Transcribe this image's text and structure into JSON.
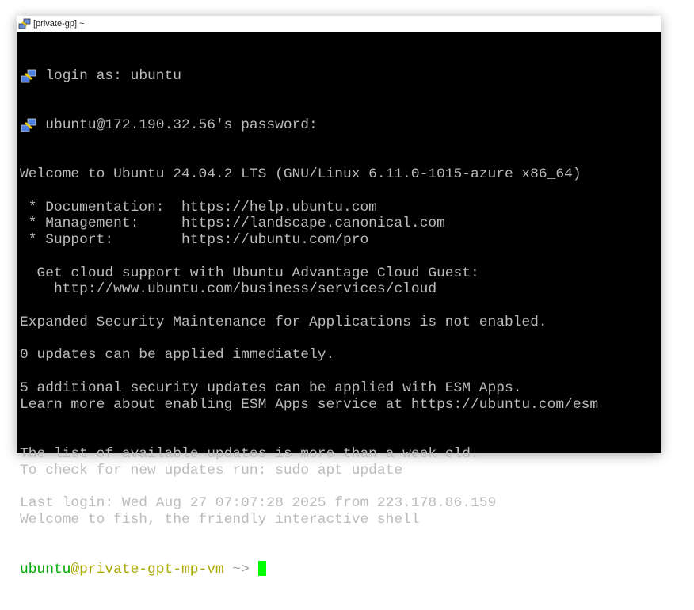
{
  "window": {
    "title": "[private-gp] ~"
  },
  "terminal": {
    "login_lines": [
      "login as: ubuntu",
      "ubuntu@172.190.32.56's password:"
    ],
    "lines": [
      "Welcome to Ubuntu 24.04.2 LTS (GNU/Linux 6.11.0-1015-azure x86_64)",
      "",
      " * Documentation:  https://help.ubuntu.com",
      " * Management:     https://landscape.canonical.com",
      " * Support:        https://ubuntu.com/pro",
      "",
      "  Get cloud support with Ubuntu Advantage Cloud Guest:",
      "    http://www.ubuntu.com/business/services/cloud",
      "",
      "Expanded Security Maintenance for Applications is not enabled.",
      "",
      "0 updates can be applied immediately.",
      "",
      "5 additional security updates can be applied with ESM Apps.",
      "Learn more about enabling ESM Apps service at https://ubuntu.com/esm",
      "",
      "",
      "The list of available updates is more than a week old.",
      "To check for new updates run: sudo apt update",
      "",
      "Last login: Wed Aug 27 07:07:28 2025 from 223.178.86.159",
      "Welcome to fish, the friendly interactive shell"
    ],
    "prompt": {
      "user": "ubuntu",
      "host": "@private-gpt-mp-vm",
      "path": " ~> "
    }
  },
  "colors": {
    "user": "#00a800",
    "host": "#a8a800",
    "cursor": "#00ff00",
    "text": "#bbbbbb"
  }
}
